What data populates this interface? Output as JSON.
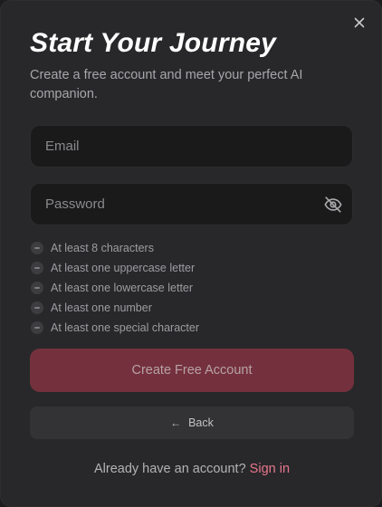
{
  "modal": {
    "close_icon": "close-icon",
    "title": "Start Your Journey",
    "subtitle": "Create a free account and meet your perfect AI companion."
  },
  "form": {
    "email": {
      "placeholder": "Email",
      "value": ""
    },
    "password": {
      "placeholder": "Password",
      "value": "",
      "toggle_icon": "eye-off-icon"
    },
    "requirements": [
      {
        "label": "At least 8 characters",
        "met": false
      },
      {
        "label": "At least one uppercase letter",
        "met": false
      },
      {
        "label": "At least one lowercase letter",
        "met": false
      },
      {
        "label": "At least one number",
        "met": false
      },
      {
        "label": "At least one special character",
        "met": false
      }
    ],
    "submit_label": "Create Free Account",
    "back_label": "Back",
    "back_icon": "arrow-left-icon"
  },
  "footer": {
    "prompt": "Already have an account?",
    "signin_label": "Sign in"
  },
  "colors": {
    "accent": "#e8768c",
    "submit_disabled_bg": "#74313d",
    "modal_bg": "#28282a",
    "input_bg": "#1a1a1b"
  }
}
